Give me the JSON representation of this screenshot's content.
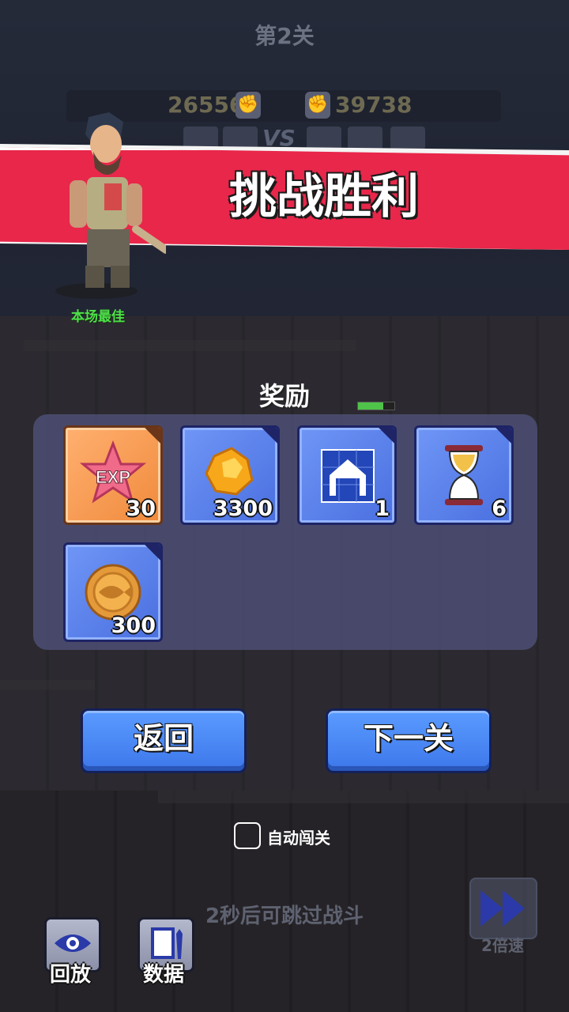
{
  "header": {
    "level_title": "第2关",
    "score_left": "26556",
    "score_right": "39738",
    "vs": "VS"
  },
  "banner": {
    "title": "挑战胜利"
  },
  "hero": {
    "best_label": "本场最佳"
  },
  "rewards": {
    "title": "奖励",
    "items": [
      {
        "icon": "exp-star-icon",
        "label": "EXP",
        "count": "30"
      },
      {
        "icon": "gold-nugget-icon",
        "count": "3300"
      },
      {
        "icon": "blueprint-house-icon",
        "count": "1"
      },
      {
        "icon": "hourglass-icon",
        "count": "6"
      },
      {
        "icon": "fish-coin-icon",
        "count": "300"
      }
    ]
  },
  "buttons": {
    "back": "返回",
    "next": "下一关"
  },
  "auto": {
    "label": "自动闯关",
    "checked": false
  },
  "skip_hint": "2秒后可跳过战斗",
  "speed": {
    "label": "2倍速"
  },
  "side": {
    "replay": "回放",
    "stats": "数据"
  },
  "colors": {
    "banner": "#e8274a",
    "button": "#4a86f5",
    "best_label": "#4de04a",
    "item_blue": "#5b82ee",
    "item_orange": "#f39a4c"
  }
}
